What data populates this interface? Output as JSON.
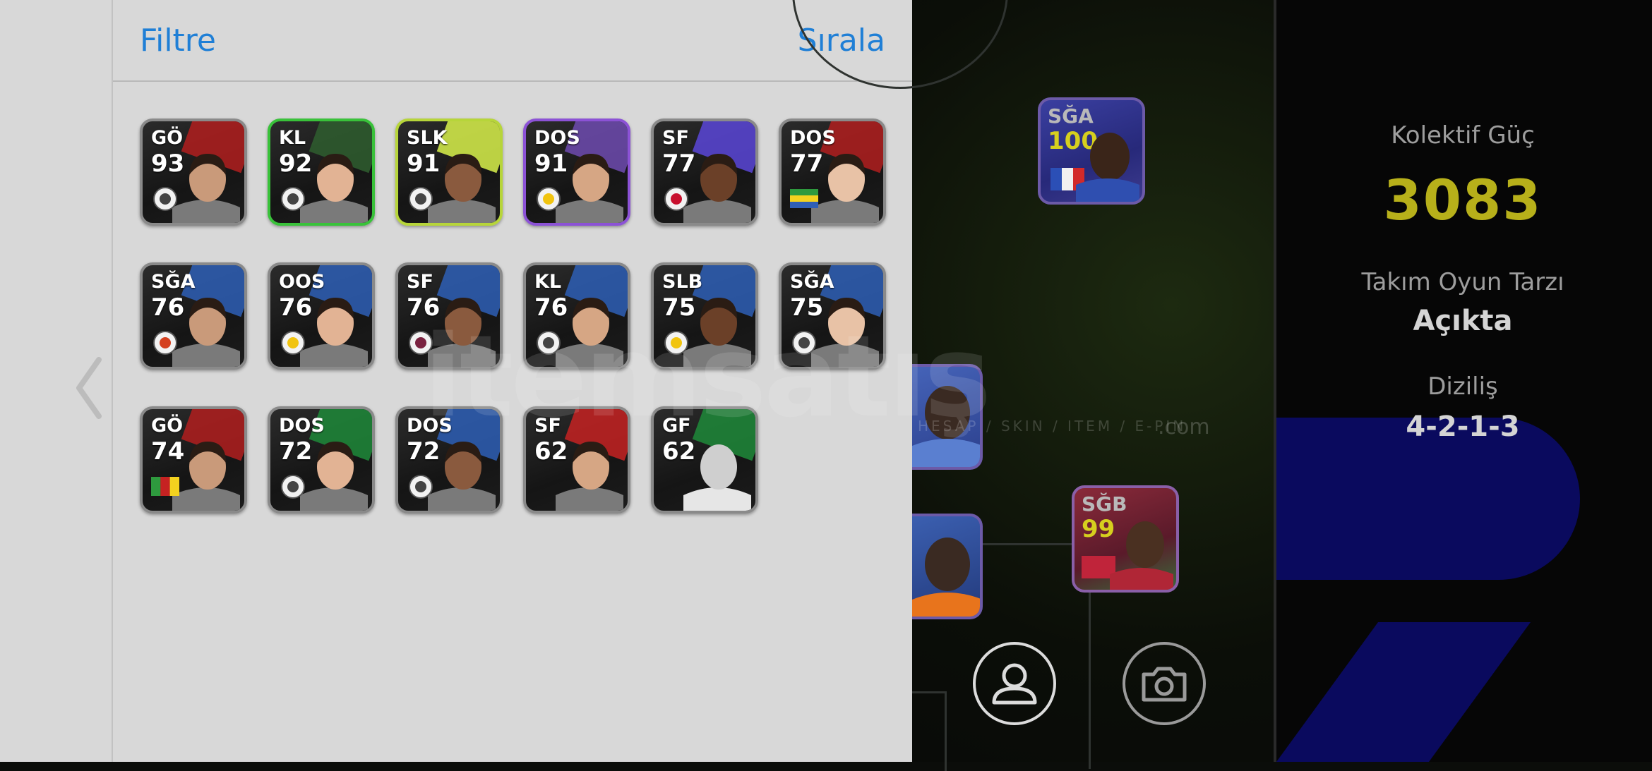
{
  "header": {
    "filter_label": "Filtre",
    "sort_label": "Sırala"
  },
  "roster": [
    {
      "pos": "GÖ",
      "ovr": "93",
      "frame": "#8a8a8a",
      "stripe": "#b21e1e",
      "badge": "club-crest-icon"
    },
    {
      "pos": "KL",
      "ovr": "92",
      "frame": "#39c23a",
      "stripe": "#2f5e2f",
      "badge": "club-crest-icon"
    },
    {
      "pos": "SLK",
      "ovr": "91",
      "frame": "#b7d53a",
      "stripe": "#d9f24b",
      "badge": "club-crest-icon"
    },
    {
      "pos": "DOS",
      "ovr": "91",
      "frame": "#8c52d6",
      "stripe": "#6e4bb0",
      "badge": "fenerbahce-crest-icon"
    },
    {
      "pos": "SF",
      "ovr": "77",
      "frame": "#8a8a8a",
      "stripe": "#5b47d8",
      "badge": "arsenal-crest-icon"
    },
    {
      "pos": "DOS",
      "ovr": "77",
      "frame": "#8a8a8a",
      "stripe": "#b21e1e",
      "badge": "gabon-flag-icon"
    },
    {
      "pos": "SĞA",
      "ovr": "76",
      "frame": "#8a8a8a",
      "stripe": "#2e5fb6",
      "badge": "galatasaray-crest-icon"
    },
    {
      "pos": "OOS",
      "ovr": "76",
      "frame": "#8a8a8a",
      "stripe": "#2e5fb6",
      "badge": "fenerbahce-crest-icon"
    },
    {
      "pos": "SF",
      "ovr": "76",
      "frame": "#8a8a8a",
      "stripe": "#2e5fb6",
      "badge": "trabzonspor-crest-icon"
    },
    {
      "pos": "KL",
      "ovr": "76",
      "frame": "#8a8a8a",
      "stripe": "#2e5fb6",
      "badge": "besiktas-crest-icon"
    },
    {
      "pos": "SLB",
      "ovr": "75",
      "frame": "#8a8a8a",
      "stripe": "#2e5fb6",
      "badge": "fenerbahce-crest-icon"
    },
    {
      "pos": "SĞA",
      "ovr": "75",
      "frame": "#8a8a8a",
      "stripe": "#2e5fb6",
      "badge": "besiktas-crest-icon"
    },
    {
      "pos": "GÖ",
      "ovr": "74",
      "frame": "#8a8a8a",
      "stripe": "#b21e1e",
      "badge": "cameroon-flag-icon"
    },
    {
      "pos": "DOS",
      "ovr": "72",
      "frame": "#8a8a8a",
      "stripe": "#1e8a3a",
      "badge": "club-crest-icon"
    },
    {
      "pos": "DOS",
      "ovr": "72",
      "frame": "#8a8a8a",
      "stripe": "#2e5fb6",
      "badge": "club-crest-icon"
    },
    {
      "pos": "SF",
      "ovr": "62",
      "frame": "#8a8a8a",
      "stripe": "#c62222",
      "badge": "none"
    },
    {
      "pos": "GF",
      "ovr": "62",
      "frame": "#8a8a8a",
      "stripe": "#1e8a3a",
      "badge": "none"
    }
  ],
  "sidebar": {
    "team_power_label": "Kolektif Güç",
    "team_power_value": "3083",
    "play_style_label": "Takım Oyun Tarzı",
    "play_style_value": "Açıkta",
    "formation_label": "Diziliş",
    "formation_value": "4-2-1-3"
  },
  "pitch_players": [
    {
      "pos": "SĞA",
      "ovr": "100",
      "flag": "france"
    },
    {
      "pos": "SĞB",
      "ovr": "99",
      "flag": "morocco"
    }
  ],
  "watermark": {
    "main": "itemsatış",
    "sub": "HESAP / SKIN / ITEM / E-PIN",
    "com": ".com"
  },
  "colors": {
    "accent_blue": "#1f7fd6",
    "team_power": "#b7b01a",
    "panel_bg": "#d8d8d8"
  }
}
